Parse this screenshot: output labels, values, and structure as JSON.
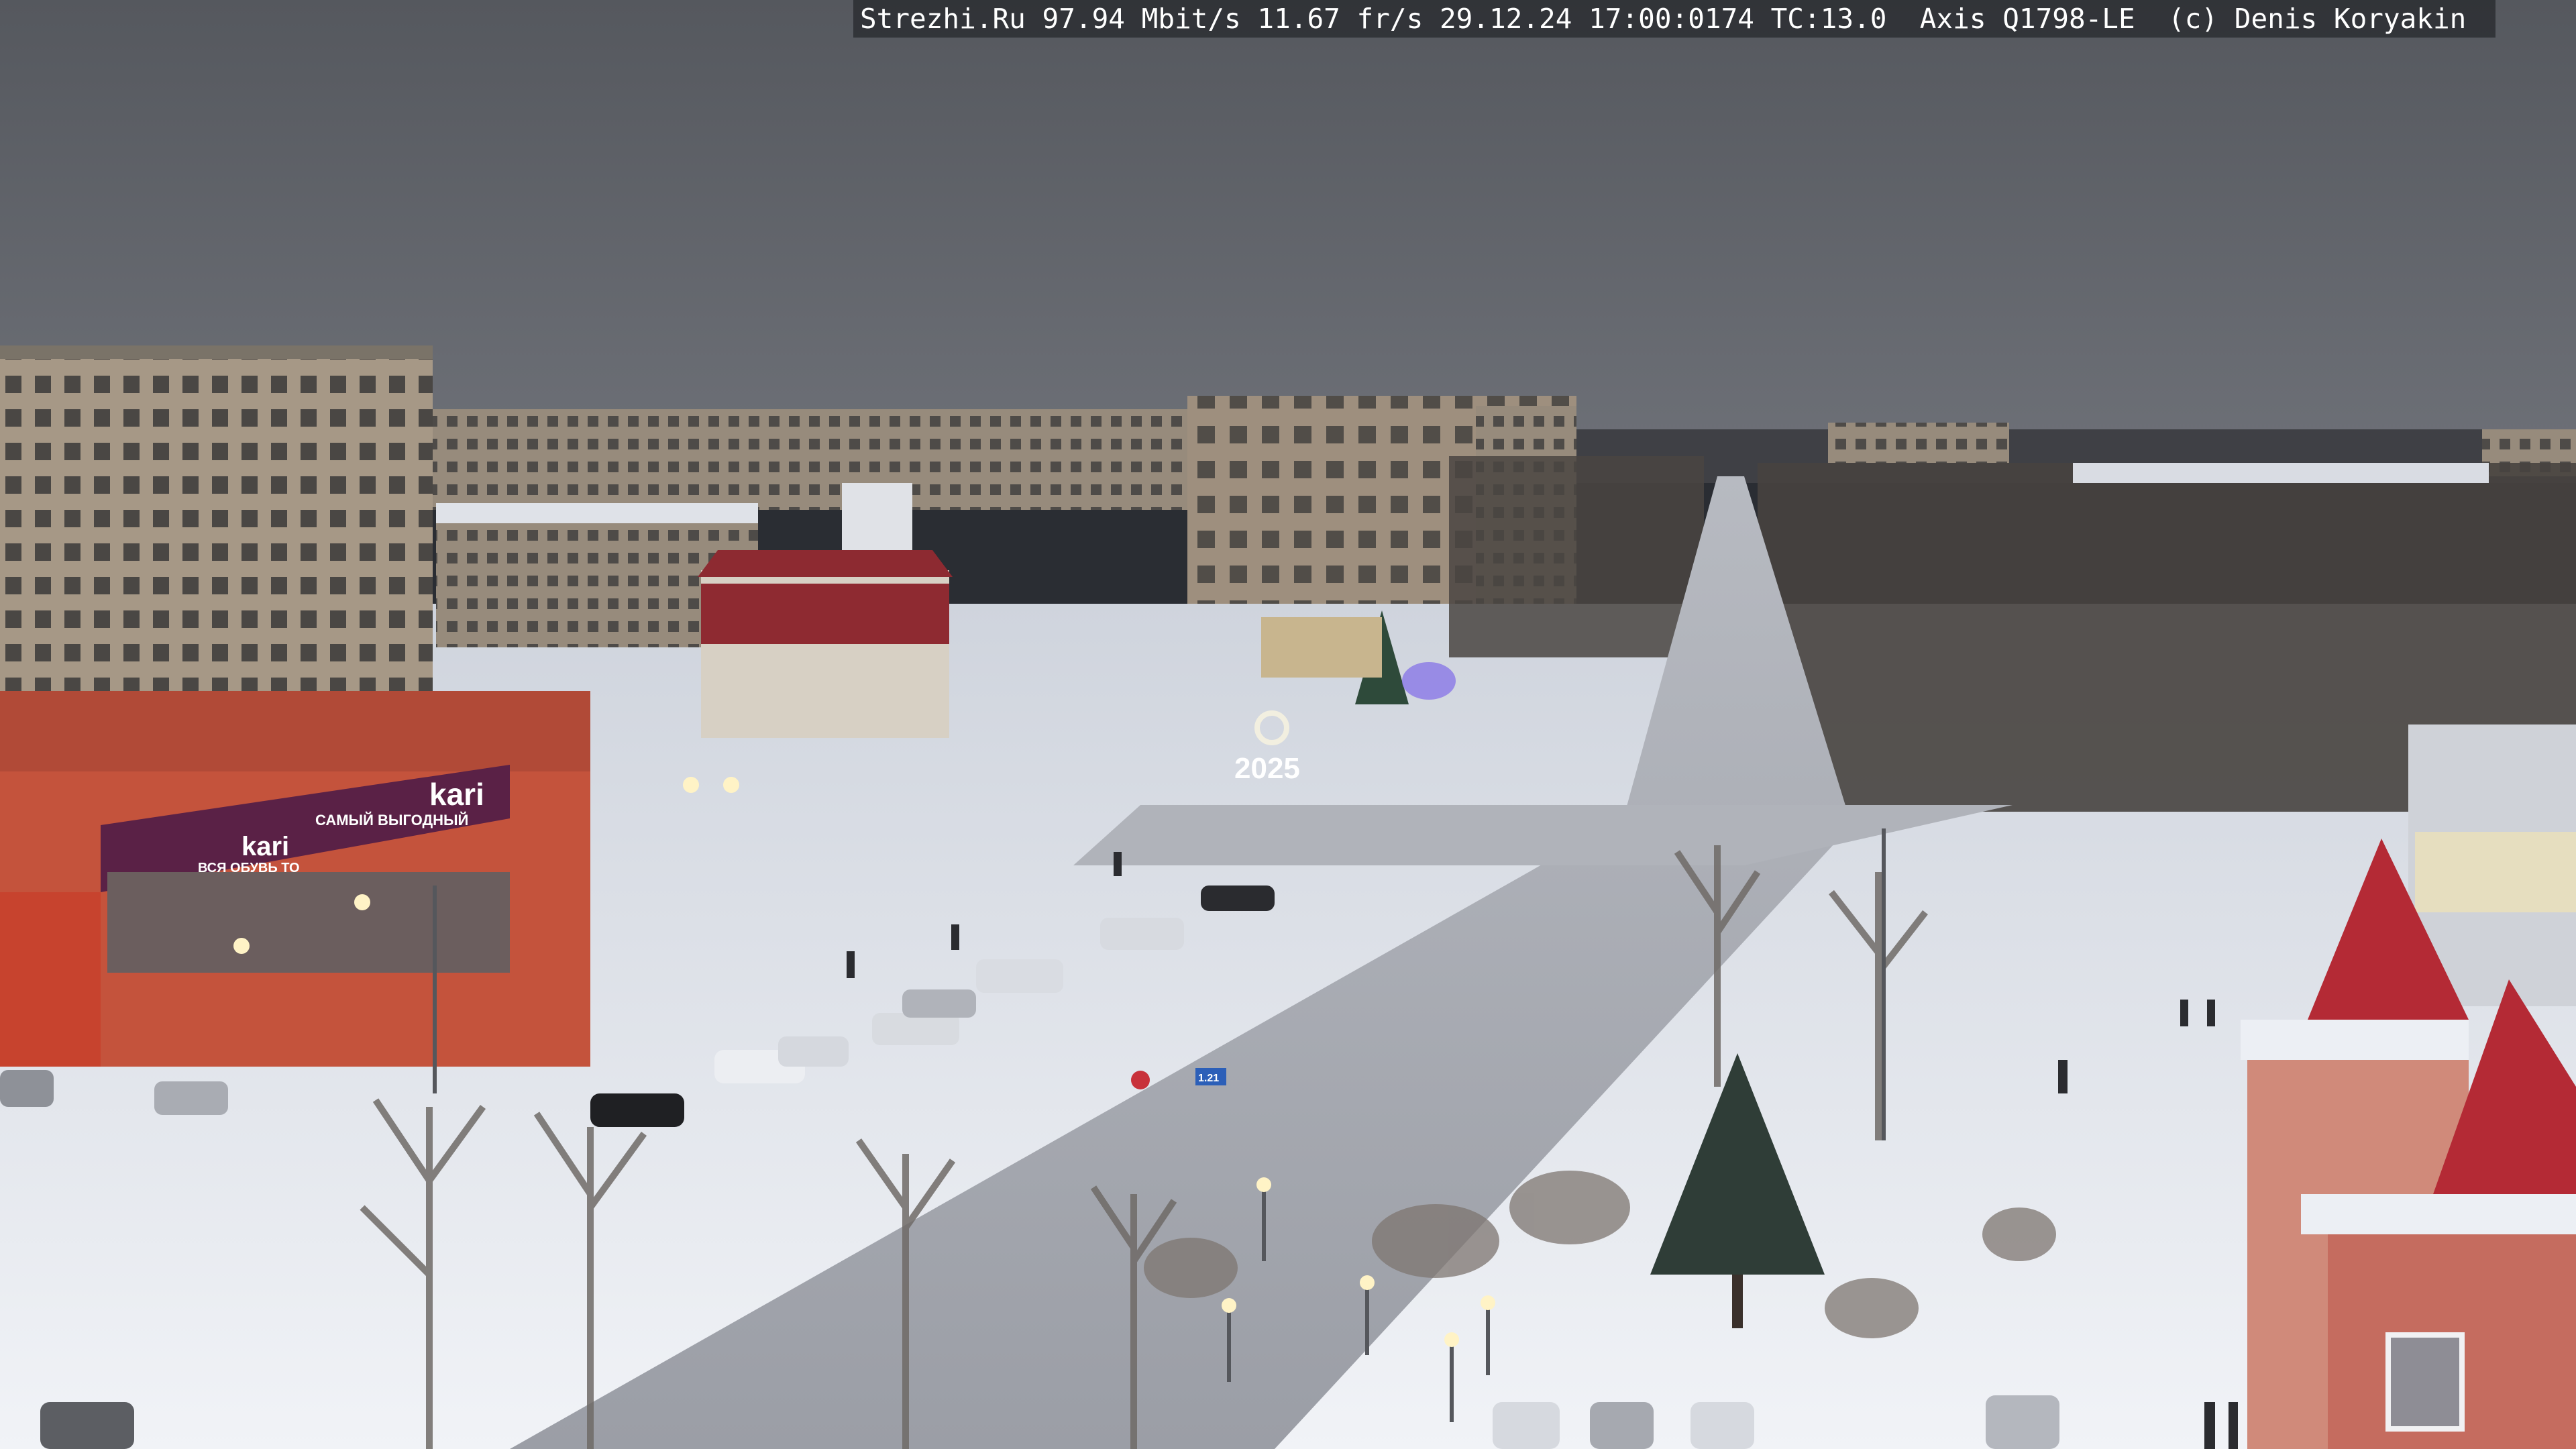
{
  "overlay": {
    "text": "Strezhi.Ru 97.94 Mbit/s 11.67 fr/s 29.12.24 17:00:0174 TC:13.0  Axis Q1798-LE  (c) Denis Koryakin"
  },
  "signs": {
    "kari_main": "kari",
    "kari_side": "kari",
    "store_slogan": "САМЫЙ ВЫГОДНЫЙ",
    "store_slogan_small": "ВСЯ ОБУВЬ ТО",
    "new_year": "2025",
    "road_sign": "1.21"
  },
  "colors": {
    "sky": "#5d6066",
    "snow": "#e9ecf2",
    "road": "#a9acb4",
    "store_facade": "#c5523a",
    "kari_banner": "#5a2146",
    "roof_red": "#9a2a33",
    "panel_building": "#a69886"
  }
}
